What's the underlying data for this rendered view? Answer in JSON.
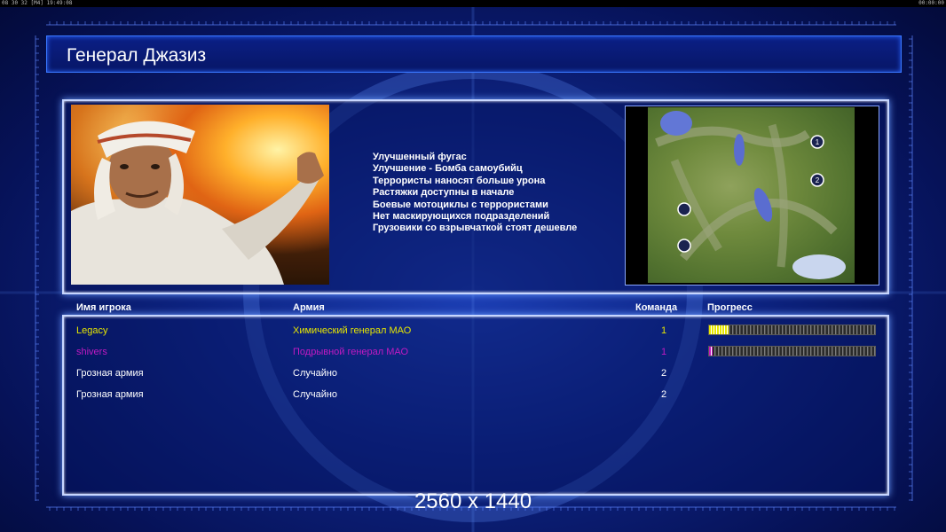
{
  "status_bar": {
    "left": "08 30 32 [M4] 19:49:08",
    "right": "00:00:00"
  },
  "header": {
    "title": "Генерал Джазиз"
  },
  "general": {
    "features": [
      "Улучшенный фугас",
      "Улучшение - Бомба самоубийц",
      "Террористы наносят больше урона",
      "Растяжки доступны в начале",
      "Боевые мотоциклы с террористами",
      "Нет маскирующихся подразделений",
      "Грузовики со взрывчаткой стоят дешевле"
    ]
  },
  "minimap": {
    "markers": [
      "1",
      "2"
    ]
  },
  "players_table": {
    "headers": {
      "name": "Имя игрока",
      "army": "Армия",
      "team": "Команда",
      "progress": "Прогресс"
    },
    "rows": [
      {
        "name": "Legacy",
        "army": "Химический генерал МАО",
        "team": "1",
        "color": "#e6e600",
        "progress": 0.12
      },
      {
        "name": "shivers",
        "army": "Подрывной генерал МАО",
        "team": "1",
        "color": "#c21ac2",
        "progress": 0.02
      },
      {
        "name": "Грозная армия",
        "army": "Случайно",
        "team": "2",
        "color": "#ffffff",
        "progress": null
      },
      {
        "name": "Грозная армия",
        "army": "Случайно",
        "team": "2",
        "color": "#ffffff",
        "progress": null
      }
    ]
  },
  "watermark": "2560 x 1440"
}
